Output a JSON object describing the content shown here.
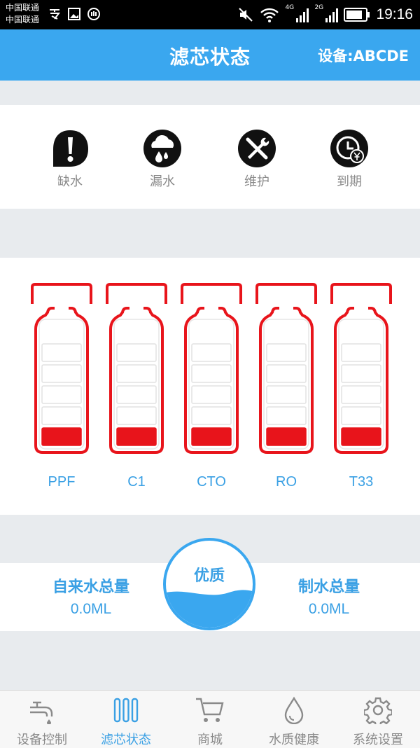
{
  "status_bar": {
    "carrier_1": "中国联通",
    "carrier_2": "中国联通",
    "net_4g": "4G",
    "net_2g": "2G",
    "time": "19:16"
  },
  "header": {
    "title": "滤芯状态",
    "device": "设备:ABCDE"
  },
  "status_icons": [
    {
      "label": "缺水",
      "icon": "exclamation-icon"
    },
    {
      "label": "漏水",
      "icon": "leak-cloud-icon"
    },
    {
      "label": "维护",
      "icon": "tools-icon"
    },
    {
      "label": "到期",
      "icon": "clock-yen-icon"
    }
  ],
  "filters": [
    {
      "name": "PPF",
      "level_segments": 1,
      "total_segments": 5
    },
    {
      "name": "C1",
      "level_segments": 1,
      "total_segments": 5
    },
    {
      "name": "CTO",
      "level_segments": 1,
      "total_segments": 5
    },
    {
      "name": "RO",
      "level_segments": 1,
      "total_segments": 5
    },
    {
      "name": "T33",
      "level_segments": 1,
      "total_segments": 5
    }
  ],
  "water": {
    "tap_title": "自来水总量",
    "tap_value": "0.0ML",
    "quality": "优质",
    "produced_title": "制水总量",
    "produced_value": "0.0ML"
  },
  "bottom_nav": [
    {
      "label": "设备控制",
      "icon": "faucet-icon",
      "active": false
    },
    {
      "label": "滤芯状态",
      "icon": "filter-bars-icon",
      "active": true
    },
    {
      "label": "商城",
      "icon": "cart-icon",
      "active": false
    },
    {
      "label": "水质健康",
      "icon": "water-drop-icon",
      "active": false
    },
    {
      "label": "系统设置",
      "icon": "gear-icon",
      "active": false
    }
  ],
  "colors": {
    "accent": "#3aa7ef",
    "filter_red": "#e8141b",
    "text_gray": "#8a8a8a"
  }
}
